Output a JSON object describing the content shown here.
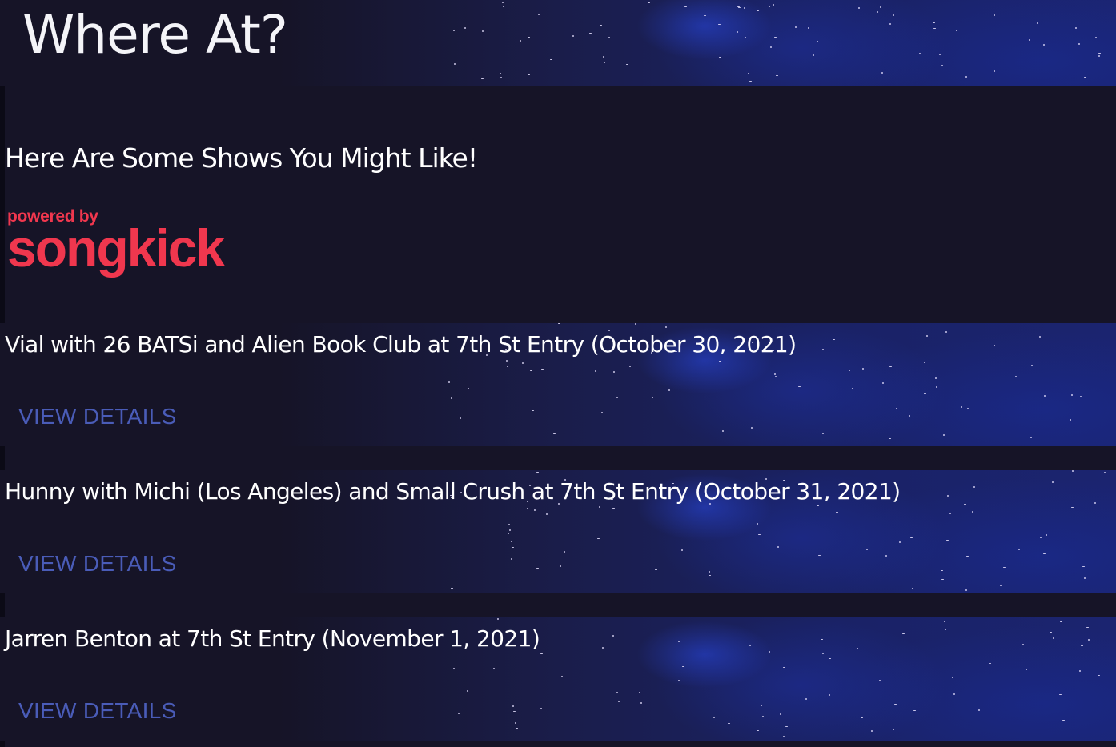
{
  "header": {
    "title": "Where At?"
  },
  "subtitle": "Here Are Some Shows You Might Like!",
  "attribution": {
    "powered_by": "powered by",
    "brand": "songkick",
    "brand_color": "#f0374e"
  },
  "events": [
    {
      "title": "Vial with 26 BATSi and Alien Book Club at 7th St Entry (October 30, 2021)",
      "link_label": "VIEW DETAILS"
    },
    {
      "title": "Hunny with Michi (Los Angeles) and Small Crush at 7th St Entry (October 31, 2021)",
      "link_label": "VIEW DETAILS"
    },
    {
      "title": "Jarren Benton at 7th St Entry (November 1, 2021)",
      "link_label": "VIEW DETAILS"
    }
  ],
  "colors": {
    "background": "#161427",
    "link": "#4a5cb8",
    "text": "#ffffff"
  }
}
